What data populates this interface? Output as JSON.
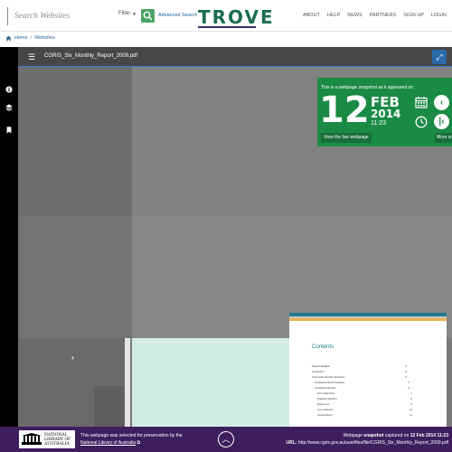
{
  "header": {
    "search_placeholder": "Search Websites",
    "filter_label": "Filter",
    "advanced_search_label": "Advanced Search",
    "logo_text": "TROVE",
    "nav": [
      "ABOUT",
      "HELP",
      "NEWS",
      "PARTNERS",
      "SIGN UP",
      "LOGIN"
    ]
  },
  "breadcrumb": {
    "home": "Home",
    "separator": "/",
    "current": "Websites"
  },
  "viewer": {
    "filename": "CGRIS_Six_Monthly_Report_2009.pdf",
    "page_number_label": "4"
  },
  "snapshot": {
    "note": "This is a webpage snapshot as it appeared on",
    "day": "12",
    "month": "FEB",
    "year": "2014",
    "time": "11:23",
    "view_live_label": "View the live webpage",
    "more_label": "More sn"
  },
  "toc": {
    "title": "Contents",
    "rows": [
      {
        "label": "Report Highlights",
        "page": "3"
      },
      {
        "label": "Introduction",
        "page": "4"
      },
      {
        "label": "Commodity Specific Information",
        "page": "5"
      },
      {
        "label": "Compliance Recent Updates",
        "page": "5"
      },
      {
        "label": "Compliance Reports",
        "page": "6"
      },
      {
        "label": "Farm Gate Price",
        "page": "7"
      },
      {
        "label": "Quarterly Statistics",
        "page": "8"
      },
      {
        "label": "Export Levy",
        "page": "9"
      },
      {
        "label": "Levy Collection",
        "page": "10"
      },
      {
        "label": "Annual Report",
        "page": "11"
      }
    ]
  },
  "footer": {
    "nla_logo_text": "NATIONAL LIBRARY OF AUSTRALIA",
    "preservation_note": "This webpage was selected for preservation by the",
    "preservation_link": "National Library of Australia",
    "snapshot_prefix": "Webpage",
    "snapshot_word": "snapshot",
    "snapshot_middle": "captured on",
    "snapshot_date": "12 Feb 2014 11:23",
    "url_label": "URL:",
    "url_value": "http://www.cgris.gov.au/userfiles/file/CGRIS_Six_Monthly_Report_2009.pdf"
  },
  "colors": {
    "trove_green": "#1a6e4e",
    "snapshot_green": "#1a8a45",
    "footer_purple": "#3d1f5e",
    "viewer_gray": "#7a7a7a"
  },
  "icons": [
    "search-icon",
    "home-icon",
    "menu-icon",
    "expand-icon",
    "info-icon",
    "layers-icon",
    "bookmark-icon",
    "calendar-icon",
    "clock-icon",
    "chevron-left-icon",
    "skip-back-icon",
    "external-link-icon",
    "chevron-up-icon"
  ]
}
